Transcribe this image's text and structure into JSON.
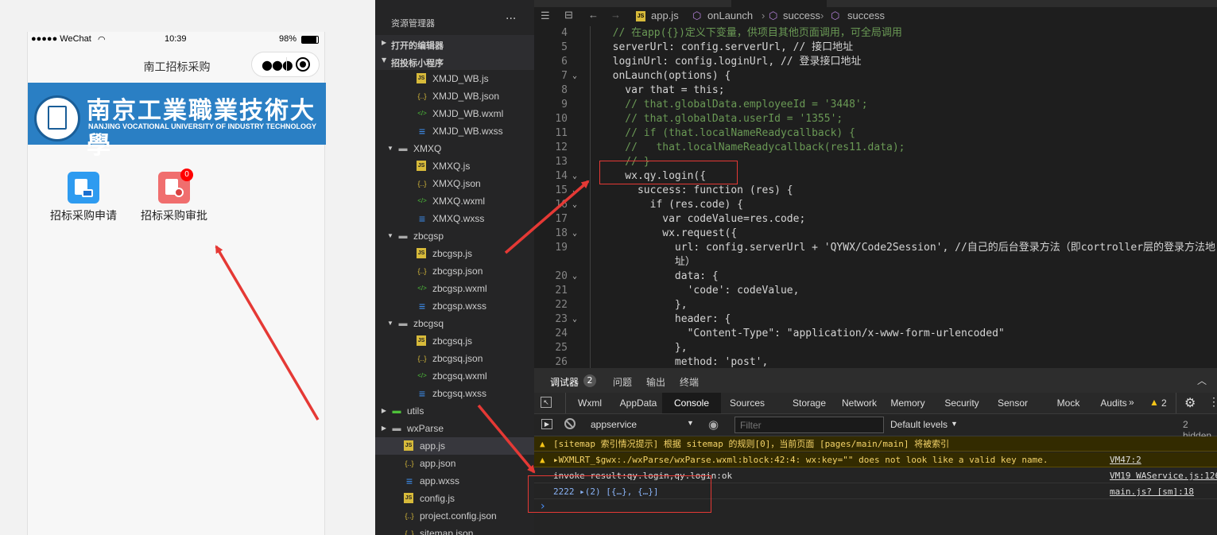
{
  "simulator": {
    "status": {
      "carrier": "●●●●● WeChat",
      "time": "10:39",
      "battery": "98%"
    },
    "nav_title": "南工招标采购",
    "banner": {
      "cn": "南京工業職業技術大學",
      "en": "NANJING VOCATIONAL UNIVERSITY OF INDUSTRY TECHNOLOGY"
    },
    "apps": [
      {
        "label": "招标采购申请",
        "color": "#2e9bf0"
      },
      {
        "label": "招标采购审批",
        "color": "#f06e6e",
        "badge": "0"
      }
    ]
  },
  "explorer": {
    "title": "资源管理器",
    "menu": "···",
    "sections": [
      "打开的编辑器",
      "招投标小程序"
    ],
    "items": [
      {
        "label": "XMJD_WB.js",
        "icon": "js"
      },
      {
        "label": "XMJD_WB.json",
        "icon": "json"
      },
      {
        "label": "XMJD_WB.wxml",
        "icon": "wxml"
      },
      {
        "label": "XMJD_WB.wxss",
        "icon": "wxss"
      },
      {
        "label": "XMXQ",
        "icon": "folder-open"
      },
      {
        "label": "XMXQ.js",
        "icon": "js"
      },
      {
        "label": "XMXQ.json",
        "icon": "json"
      },
      {
        "label": "XMXQ.wxml",
        "icon": "wxml"
      },
      {
        "label": "XMXQ.wxss",
        "icon": "wxss"
      },
      {
        "label": "zbcgsp",
        "icon": "folder-open"
      },
      {
        "label": "zbcgsp.js",
        "icon": "js"
      },
      {
        "label": "zbcgsp.json",
        "icon": "json"
      },
      {
        "label": "zbcgsp.wxml",
        "icon": "wxml"
      },
      {
        "label": "zbcgsp.wxss",
        "icon": "wxss"
      },
      {
        "label": "zbcgsq",
        "icon": "folder-open"
      },
      {
        "label": "zbcgsq.js",
        "icon": "js"
      },
      {
        "label": "zbcgsq.json",
        "icon": "json"
      },
      {
        "label": "zbcgsq.wxml",
        "icon": "wxml"
      },
      {
        "label": "zbcgsq.wxss",
        "icon": "wxss"
      },
      {
        "label": "utils",
        "icon": "folder-closed"
      },
      {
        "label": "wxParse",
        "icon": "folder-closed"
      },
      {
        "label": "app.js",
        "icon": "js",
        "selected": true
      },
      {
        "label": "app.json",
        "icon": "json"
      },
      {
        "label": "app.wxss",
        "icon": "wxss"
      },
      {
        "label": "config.js",
        "icon": "js"
      },
      {
        "label": "project.config.json",
        "icon": "json"
      },
      {
        "label": "sitemap.json",
        "icon": "json"
      }
    ]
  },
  "editor": {
    "breadcrumbs": [
      "app.js",
      "onLaunch",
      "success",
      "success"
    ],
    "lines": [
      {
        "n": "4",
        "t": "  // 在app({})定义下变量，供项目其他页面调用，可全局调用",
        "c": "com"
      },
      {
        "n": "5",
        "t": "  serverUrl: config.serverUrl, // 接口地址"
      },
      {
        "n": "6",
        "t": "  loginUrl: config.loginUrl, // 登录接口地址"
      },
      {
        "n": "7",
        "t": "  onLaunch(options) {",
        "fold": true
      },
      {
        "n": "8",
        "t": "    var that = this;"
      },
      {
        "n": "9",
        "t": "    // that.globalData.employeeId = '3448';",
        "c": "com"
      },
      {
        "n": "10",
        "t": "    // that.globalData.userId = '1355';",
        "c": "com"
      },
      {
        "n": "11",
        "t": "    // if (that.localNameReadycallback) {",
        "c": "com"
      },
      {
        "n": "12",
        "t": "    //   that.localNameReadycallback(res11.data);",
        "c": "com"
      },
      {
        "n": "13",
        "t": "    // }",
        "c": "com"
      },
      {
        "n": "14",
        "t": "    wx.qy.login({",
        "fold": true
      },
      {
        "n": "15",
        "t": "      success: function (res) {",
        "fold": true
      },
      {
        "n": "16",
        "t": "        if (res.code) {",
        "fold": true
      },
      {
        "n": "17",
        "t": "          var codeValue=res.code;"
      },
      {
        "n": "18",
        "t": "          wx.request({",
        "fold": true
      },
      {
        "n": "19",
        "t": "            url: config.serverUrl + 'QYWX/Code2Session', //自己的后台登录方法（即cortroller层的登录方法地"
      },
      {
        "n": "",
        "t": "            址）"
      },
      {
        "n": "20",
        "t": "            data: {",
        "fold": true
      },
      {
        "n": "21",
        "t": "              'code': codeValue,"
      },
      {
        "n": "22",
        "t": "            },"
      },
      {
        "n": "23",
        "t": "            header: {",
        "fold": true
      },
      {
        "n": "24",
        "t": "              \"Content-Type\": \"application/x-www-form-urlencoded\""
      },
      {
        "n": "25",
        "t": "            },"
      },
      {
        "n": "26",
        "t": "            method: 'post',"
      }
    ]
  },
  "devtools": {
    "top_tabs": [
      {
        "label": "调试器",
        "badge": "2"
      },
      {
        "label": "问题"
      },
      {
        "label": "输出"
      },
      {
        "label": "终端"
      }
    ],
    "panel_tabs": [
      "Wxml",
      "AppData",
      "Console",
      "Sources",
      "Storage",
      "Network",
      "Memory",
      "Security",
      "Sensor",
      "Mock",
      "Audits"
    ],
    "active_tab": "Console",
    "more": "»",
    "warn_count": "2",
    "context": "appservice",
    "filter_placeholder": "Filter",
    "levels": "Default levels",
    "hidden": "2 hidden",
    "logs": [
      {
        "type": "warn",
        "text": "[sitemap 索引情况提示] 根据 sitemap 的规则[0]，当前页面 [pages/main/main] 将被索引",
        "src": ""
      },
      {
        "type": "warn",
        "text": "▸WXMLRT_$gwx:./wxParse/wxParse.wxml:block:42:4: wx:key=\"\" does not look like a valid key name.",
        "src": "VM47:2"
      },
      {
        "type": "log",
        "text": "invoke result:qy.login,qy.login:ok",
        "src": "VM19 WAService.js:126"
      },
      {
        "type": "log",
        "text": "2222 ▸(2) [{…}, {…}]",
        "src": "main.js? [sm]:18"
      }
    ],
    "prompt": "›"
  }
}
